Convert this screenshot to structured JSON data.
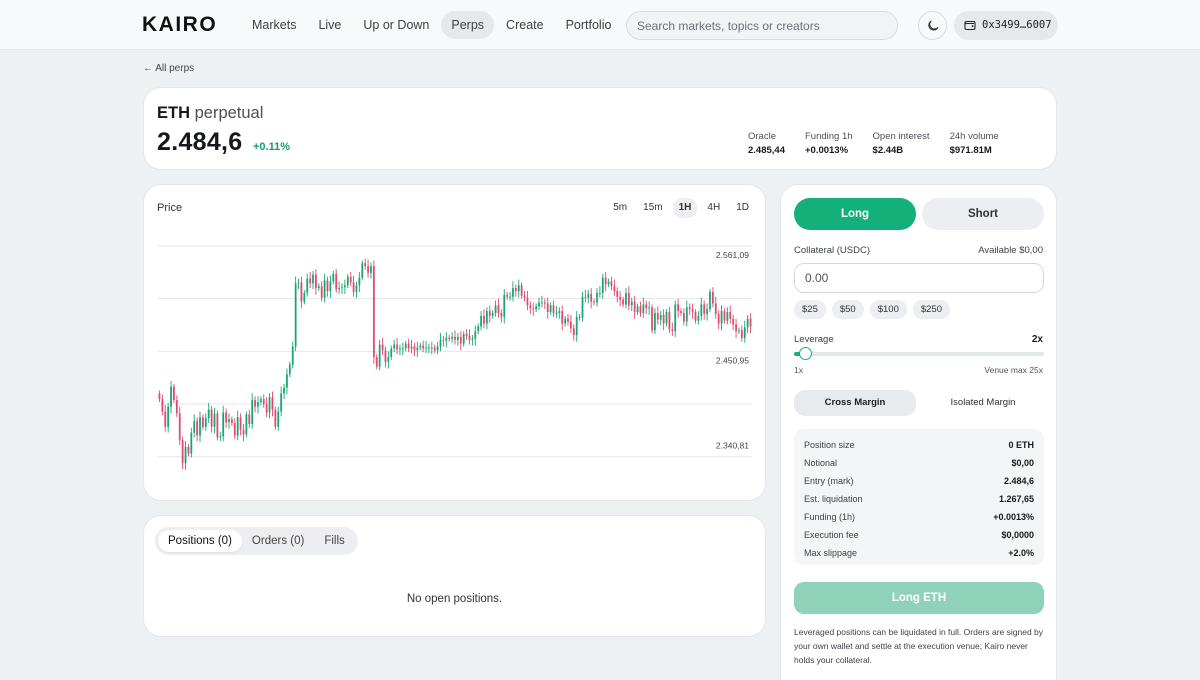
{
  "nav": {
    "logo": "KAIRO",
    "links": [
      "Markets",
      "Live",
      "Up or Down",
      "Perps",
      "Create",
      "Portfolio"
    ],
    "active_link": "Perps",
    "search_placeholder": "Search markets, topics or creators",
    "theme_icon": "moon-icon",
    "wallet_icon": "wallet-icon",
    "wallet_address": "0x3499…6007"
  },
  "back_link": "← All perps",
  "market": {
    "symbol": "ETH",
    "kind": "perpetual",
    "mark_price": "2.484,6",
    "change": "+0.11%",
    "stats": [
      {
        "label": "Oracle",
        "value": "2.485,44"
      },
      {
        "label": "Funding 1h",
        "value": "+0.0013%"
      },
      {
        "label": "Open interest",
        "value": "$2.44B"
      },
      {
        "label": "24h volume",
        "value": "$971.81M"
      }
    ]
  },
  "chart": {
    "label": "Price",
    "timeframes": [
      "5m",
      "15m",
      "1H",
      "4H",
      "1D"
    ],
    "active_timeframe": "1H"
  },
  "chart_data": {
    "type": "candlestick",
    "yticks": [
      "2.561,09",
      "2.450,95",
      "2.340,81"
    ],
    "ylim": [
      2306,
      2583
    ],
    "up_color": "#17a673",
    "down_color": "#e5486e",
    "closes": [
      2401,
      2388,
      2372,
      2393,
      2414,
      2400,
      2386,
      2358,
      2334,
      2351,
      2344,
      2366,
      2378,
      2363,
      2382,
      2372,
      2381,
      2390,
      2372,
      2386,
      2361,
      2362,
      2387,
      2377,
      2380,
      2376,
      2363,
      2382,
      2369,
      2364,
      2385,
      2375,
      2400,
      2393,
      2398,
      2401,
      2396,
      2387,
      2403,
      2390,
      2372,
      2388,
      2407,
      2413,
      2427,
      2437,
      2456,
      2522,
      2523,
      2503,
      2512,
      2527,
      2522,
      2531,
      2517,
      2519,
      2507,
      2525,
      2514,
      2524,
      2532,
      2516,
      2517,
      2518,
      2520,
      2529,
      2523,
      2513,
      2520,
      2528,
      2543,
      2540,
      2533,
      2540,
      2445,
      2435,
      2458,
      2452,
      2440,
      2445,
      2454,
      2458,
      2453,
      2454,
      2454,
      2459,
      2454,
      2456,
      2452,
      2455,
      2457,
      2454,
      2455,
      2455,
      2455,
      2452,
      2456,
      2463,
      2462,
      2465,
      2464,
      2466,
      2463,
      2466,
      2459,
      2469,
      2467,
      2463,
      2464,
      2472,
      2477,
      2488,
      2480,
      2493,
      2488,
      2491,
      2499,
      2491,
      2487,
      2510,
      2508,
      2508,
      2517,
      2514,
      2520,
      2509,
      2507,
      2499,
      2496,
      2495,
      2498,
      2502,
      2502,
      2501,
      2492,
      2499,
      2491,
      2491,
      2493,
      2480,
      2485,
      2482,
      2475,
      2468,
      2487,
      2486,
      2508,
      2507,
      2511,
      2503,
      2502,
      2512,
      2512,
      2528,
      2521,
      2524,
      2519,
      2514,
      2508,
      2505,
      2500,
      2512,
      2499,
      2503,
      2492,
      2498,
      2491,
      2500,
      2496,
      2497,
      2473,
      2491,
      2484,
      2489,
      2480,
      2492,
      2474,
      2472,
      2500,
      2493,
      2491,
      2482,
      2497,
      2495,
      2492,
      2483,
      2488,
      2500,
      2490,
      2495,
      2513,
      2501,
      2490,
      2480,
      2493,
      2483,
      2492,
      2485,
      2479,
      2472,
      2473,
      2465,
      2476,
      2485,
      2477
    ]
  },
  "positions": {
    "tabs": [
      "Positions (0)",
      "Orders (0)",
      "Fills"
    ],
    "active_tab": "Positions (0)",
    "empty_text": "No open positions."
  },
  "order": {
    "long_label": "Long",
    "short_label": "Short",
    "collateral_label": "Collateral (USDC)",
    "available": "Available $0,00",
    "collateral_placeholder": "0.00",
    "quick_amounts": [
      "$25",
      "$50",
      "$100",
      "$250"
    ],
    "leverage_label": "Leverage",
    "leverage_value": "2x",
    "leverage_fraction": 0.042,
    "leverage_min": "1x",
    "leverage_max": "Venue max 25x",
    "cross_margin": "Cross Margin",
    "isolated_margin": "Isolated Margin",
    "summary": [
      {
        "label": "Position size",
        "value": "0 ETH"
      },
      {
        "label": "Notional",
        "value": "$0,00"
      },
      {
        "label": "Entry (mark)",
        "value": "2.484,6"
      },
      {
        "label": "Est. liquidation",
        "value": "1.267,65"
      },
      {
        "label": "Funding (1h)",
        "value": "+0.0013%"
      },
      {
        "label": "Execution fee",
        "value": "$0,0000"
      },
      {
        "label": "Max slippage",
        "value": "+2.0%"
      }
    ],
    "submit_label": "Long ETH",
    "disclaimer": "Leveraged positions can be liquidated in full. Orders are signed by your own wallet and settle at the execution venue; Kairo never holds your collateral."
  }
}
